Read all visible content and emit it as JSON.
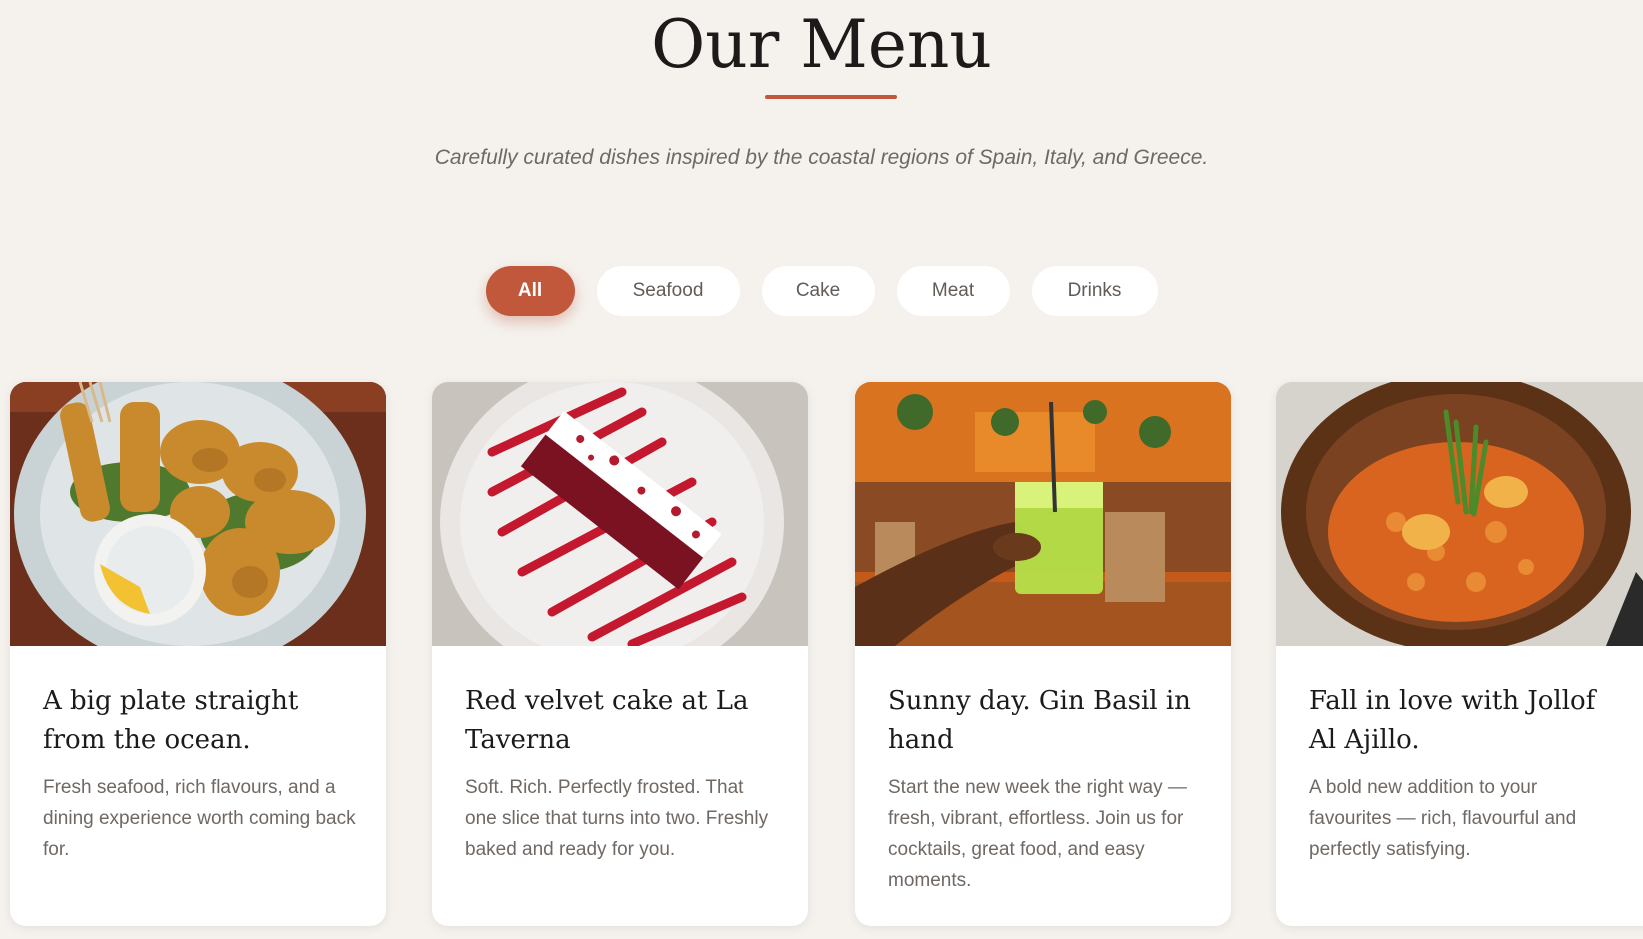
{
  "header": {
    "title": "Our Menu",
    "subtitle": "Carefully curated dishes inspired by the coastal regions of Spain, Italy, and Greece."
  },
  "filters": [
    {
      "label": "All",
      "active": true
    },
    {
      "label": "Seafood",
      "active": false
    },
    {
      "label": "Cake",
      "active": false
    },
    {
      "label": "Meat",
      "active": false
    },
    {
      "label": "Drinks",
      "active": false
    }
  ],
  "cards": [
    {
      "title": "A big plate straight from the ocean.",
      "description": "Fresh seafood, rich flavours, and a dining experience worth coming back for.",
      "image": "fried-seafood-platter-photo"
    },
    {
      "title": "Red velvet cake at La Taverna",
      "description": "Soft. Rich. Perfectly frosted. That one slice that turns into two. Freshly baked and ready for you.",
      "image": "red-velvet-cake-photo"
    },
    {
      "title": "Sunny day. Gin Basil in hand",
      "description": "Start the new week the right way — fresh, vibrant, effortless. Join us for cocktails, great food, and easy moments.",
      "image": "gin-basil-cocktail-photo"
    },
    {
      "title": "Fall in love with Jollof Al Ajillo.",
      "description": "A bold new addition to your favourites — rich, flavourful and perfectly satisfying.",
      "image": "jollof-rice-bowl-photo"
    }
  ],
  "colors": {
    "accent": "#c1583c",
    "background": "#f5f2ee",
    "card": "#ffffff",
    "heading": "#1d1b19",
    "body_text": "#6f6863"
  }
}
